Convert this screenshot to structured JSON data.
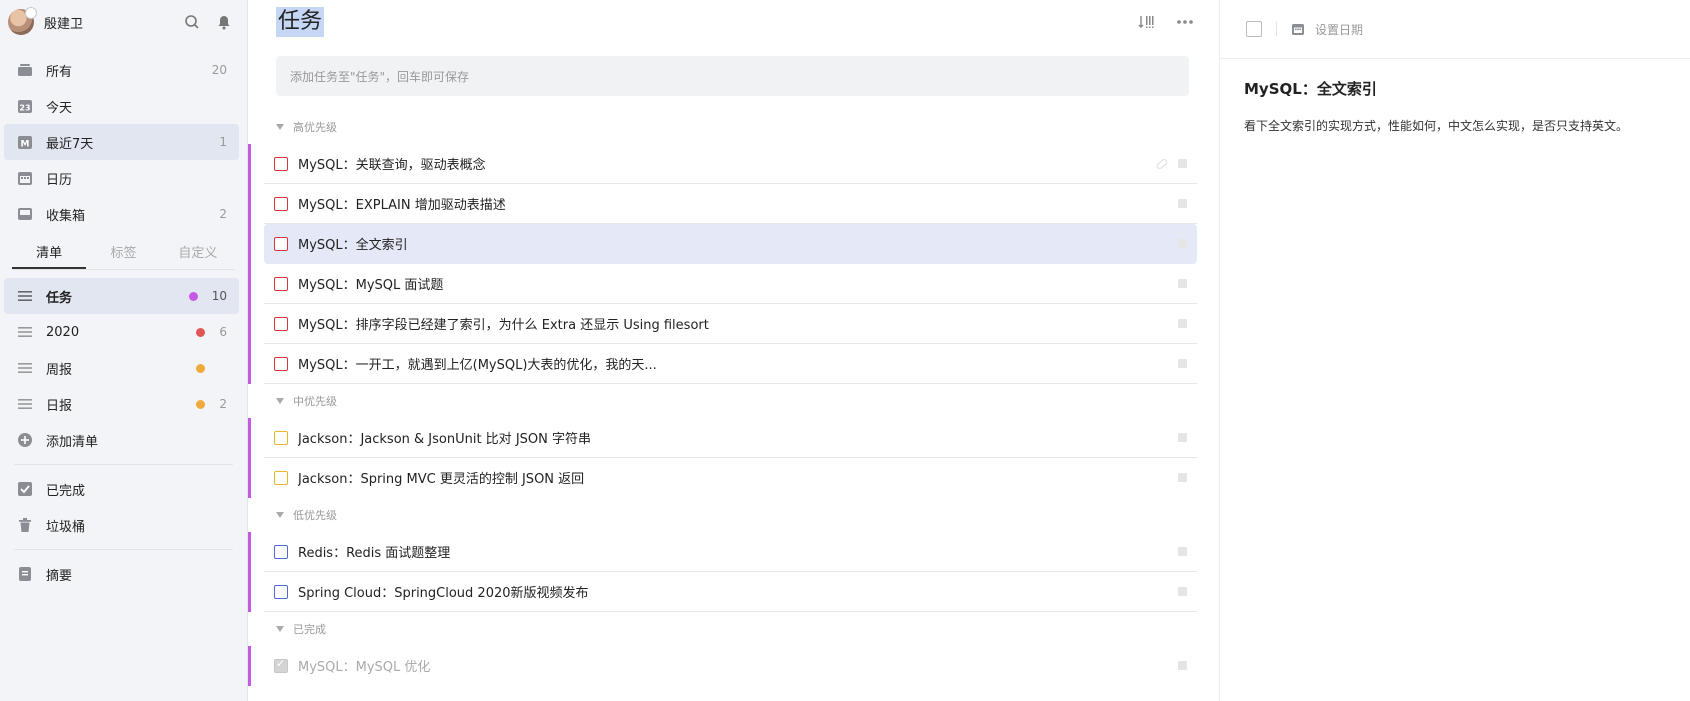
{
  "user": {
    "name": "殷建卫"
  },
  "nav": [
    {
      "label": "所有",
      "count": "20",
      "icon": "inbox-stack-icon"
    },
    {
      "label": "今天",
      "count": "",
      "icon": "calendar-23-icon"
    },
    {
      "label": "最近7天",
      "count": "1",
      "icon": "calendar-m-icon"
    },
    {
      "label": "日历",
      "count": "",
      "icon": "calendar-icon"
    },
    {
      "label": "收集箱",
      "count": "2",
      "icon": "inbox-icon"
    }
  ],
  "tabs": [
    "清单",
    "标签",
    "自定义"
  ],
  "lists": [
    {
      "label": "任务",
      "count": "10",
      "color": "#c65ae6"
    },
    {
      "label": "2020",
      "count": "6",
      "color": "#e05555"
    },
    {
      "label": "周报",
      "count": "",
      "color": "#f0a93b"
    },
    {
      "label": "日报",
      "count": "2",
      "color": "#f0a93b"
    }
  ],
  "add_list_label": "添加清单",
  "bottom_nav": [
    {
      "label": "已完成"
    },
    {
      "label": "垃圾桶"
    },
    {
      "label": "摘要"
    }
  ],
  "main": {
    "title": "任务",
    "add_placeholder": "添加任务至\"任务\"，回车即可保存",
    "groups": [
      {
        "name": "高优先级",
        "priority": "high",
        "tasks": [
          "MySQL：关联查询，驱动表概念",
          "MySQL：EXPLAIN 增加驱动表描述",
          "MySQL：全文索引",
          "MySQL：MySQL 面试题",
          "MySQL：排序字段已经建了索引，为什么 Extra 还显示 Using filesort",
          "MySQL：一开工，就遇到上亿(MySQL)大表的优化，我的天..."
        ]
      },
      {
        "name": "中优先级",
        "priority": "mid",
        "tasks": [
          "Jackson：Jackson & JsonUnit 比对 JSON 字符串",
          "Jackson：Spring MVC 更灵活的控制 JSON 返回"
        ]
      },
      {
        "name": "低优先级",
        "priority": "low",
        "tasks": [
          "Redis：Redis 面试题整理",
          "Spring Cloud：SpringCloud 2020新版视频发布"
        ]
      },
      {
        "name": "已完成",
        "priority": "done",
        "tasks": [
          "MySQL：MySQL 优化"
        ]
      }
    ]
  },
  "detail": {
    "set_date": "设置日期",
    "title": "MySQL：全文索引",
    "body": "看下全文索引的实现方式，性能如何，中文怎么实现，是否只支持英文。"
  }
}
